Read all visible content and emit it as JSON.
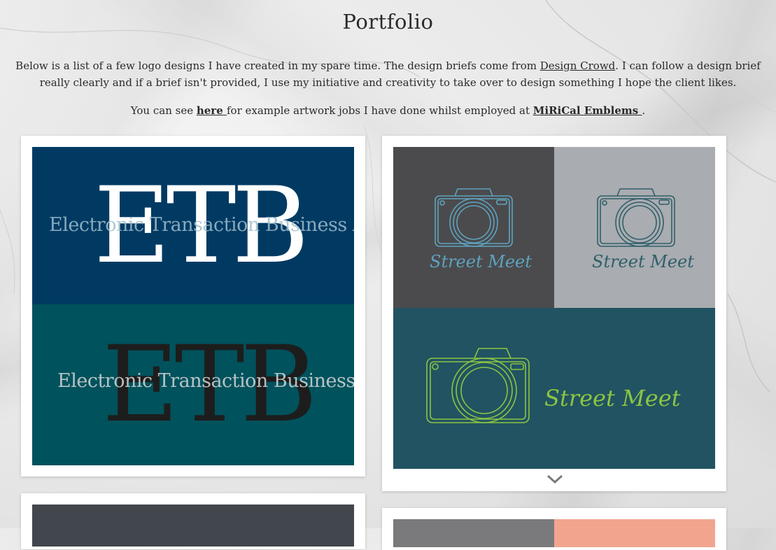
{
  "page": {
    "title": "Portfolio",
    "intro_part1": "Below is a list of a few logo designs I have created in my spare time. The design briefs come from ",
    "intro_link": "Design Crowd",
    "intro_part2": ". I can follow a design brief really clearly and if a brief isn't provided, I use my initiative and creativity to take over to design something I hope the client likes.",
    "second_part1": "You can see ",
    "second_link1": "here ",
    "second_part2": "for example artwork jobs I have done whilst employed at ",
    "second_link2": "MiRiCal Emblems ",
    "second_part3": "."
  },
  "cards": {
    "etb": {
      "logo_text_top": "ETB",
      "tagline_top": "Electronic Transaction Business AG",
      "logo_text_bottom": "ETB",
      "tagline_bottom": "Electronic Transaction Business AG",
      "colors": {
        "top_bg": "#003a63",
        "bottom_bg": "#00525c"
      }
    },
    "street_meet": {
      "label_1": "Street Meet",
      "label_2": "Street Meet",
      "label_3": "Street Meet",
      "icons": [
        "camera-icon",
        "camera-icon",
        "camera-icon",
        "chevron-down-icon"
      ],
      "colors": {
        "q1_bg": "#4b4b4d",
        "q2_bg": "#a9acb0",
        "bottom_bg": "#215362",
        "line_blue": "#5ea3bf",
        "line_teal": "#2f5f6a",
        "line_green": "#8cc443"
      }
    },
    "next_row": {
      "colors": {
        "left_bg": "#42464d",
        "right_left_bg": "#7a7a7c",
        "right_right_bg": "#f2a58e"
      }
    }
  }
}
